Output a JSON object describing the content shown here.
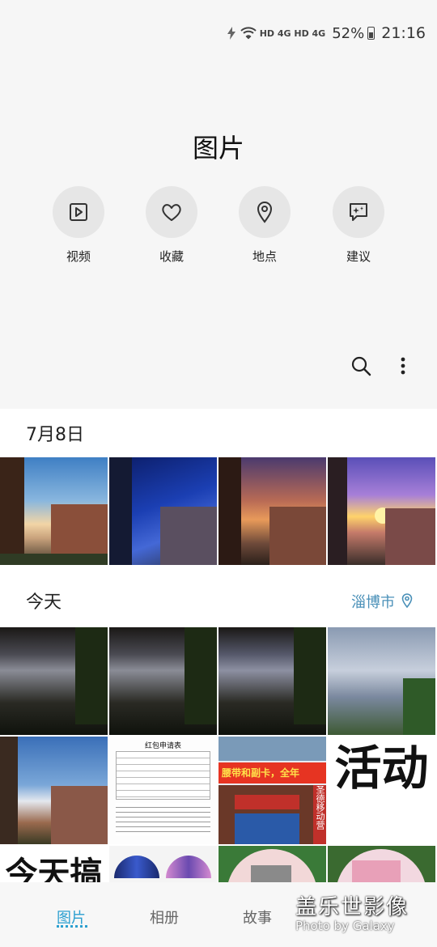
{
  "status_bar": {
    "network_icons": "HD 4G HD 4G",
    "battery_percent": "52%",
    "time": "21:16"
  },
  "header": {
    "title": "图片"
  },
  "quick_actions": [
    {
      "label": "视频",
      "icon": "video-icon"
    },
    {
      "label": "收藏",
      "icon": "heart-icon"
    },
    {
      "label": "地点",
      "icon": "location-pin-icon"
    },
    {
      "label": "建议",
      "icon": "suggestion-icon"
    }
  ],
  "toolbar": {
    "search_icon": "search-icon",
    "more_icon": "more-vertical-icon"
  },
  "sections": [
    {
      "date": "7月8日"
    },
    {
      "date": "今天",
      "location": "淄博市"
    }
  ],
  "thumbnails": {
    "doc_title": "红包申请表",
    "banner_text": "活动",
    "banner_text_2": "今天搞",
    "store_sign": "腰带和副卡，全年",
    "store_side": "圣德移动营"
  },
  "bottom_nav": {
    "tabs": [
      "图片",
      "相册",
      "故事"
    ],
    "active": 0
  },
  "watermark": {
    "cn": "盖乐世影像",
    "en": "Photo by Galaxy"
  },
  "colors": {
    "accent": "#2b9fd0",
    "location": "#4a90b8"
  }
}
